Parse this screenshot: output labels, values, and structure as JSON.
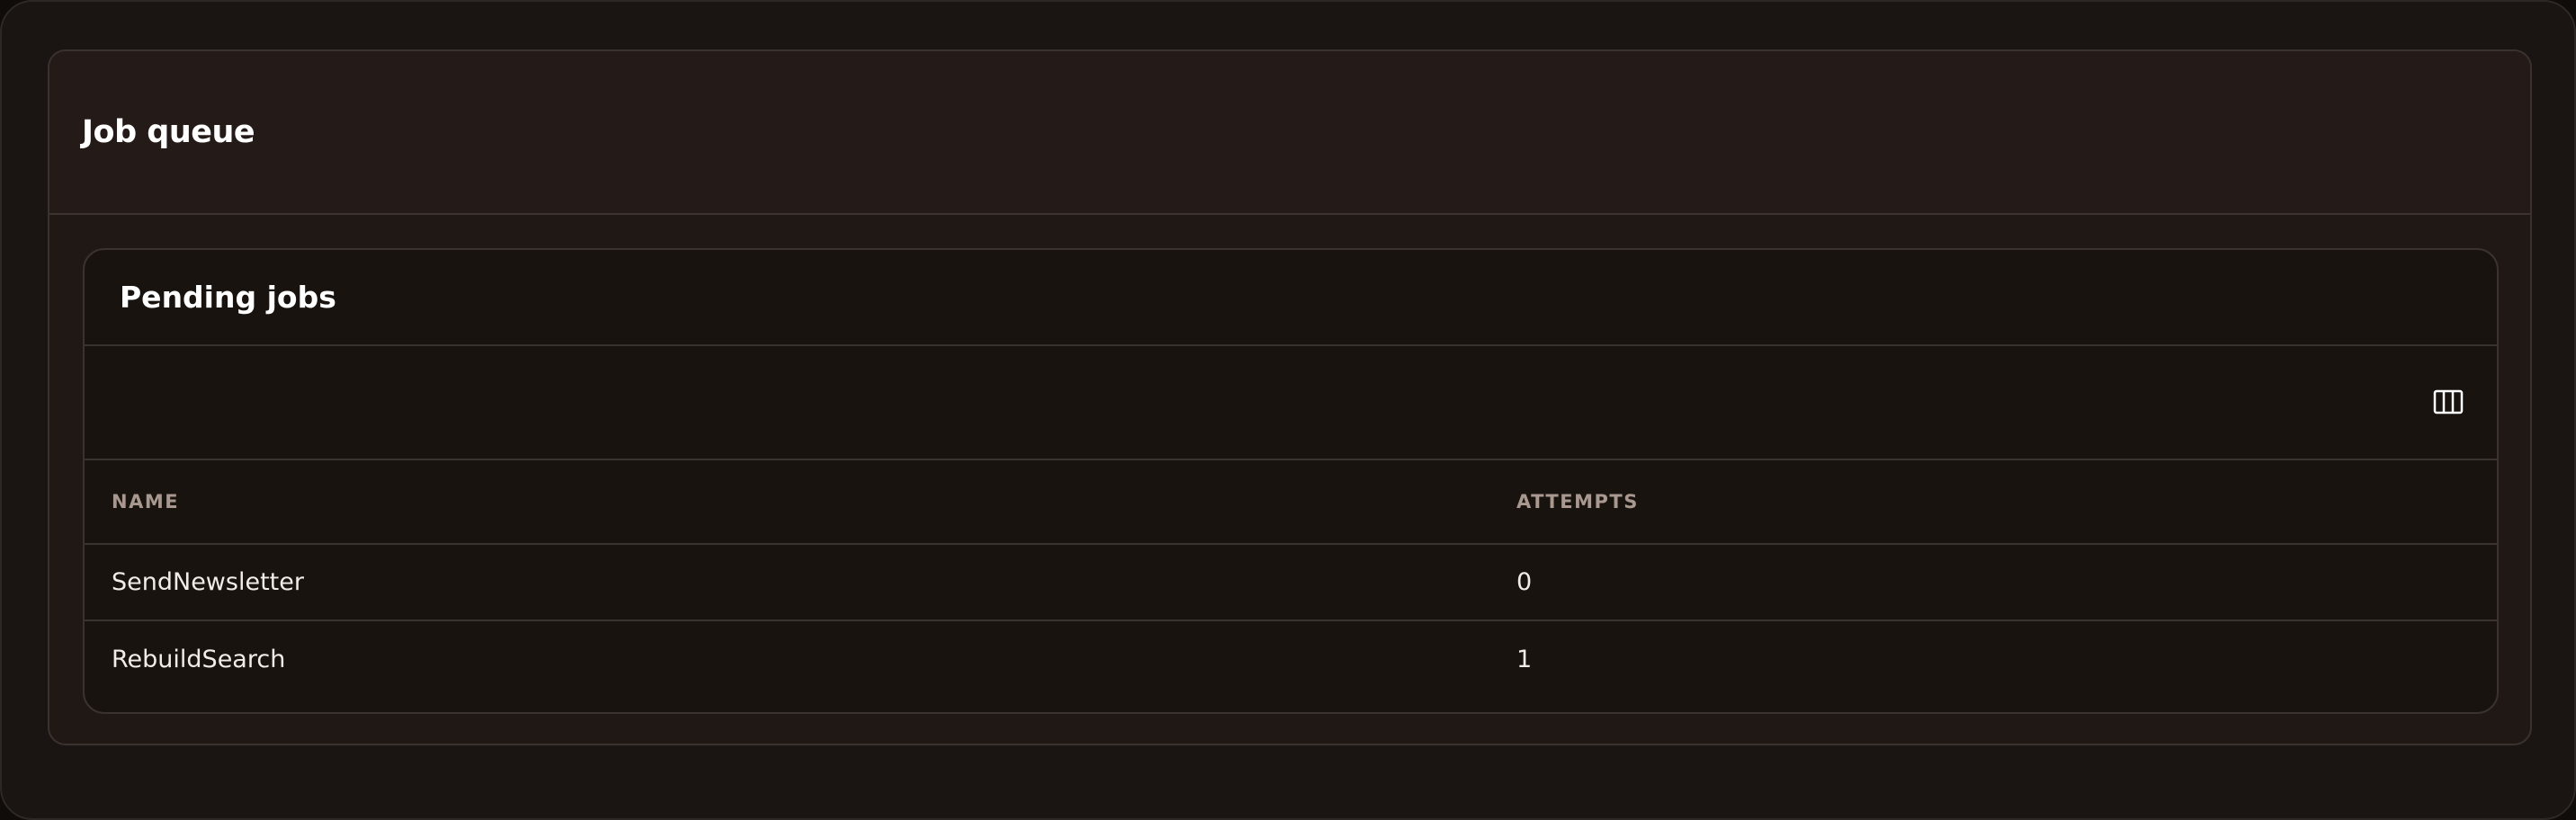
{
  "panel": {
    "title": "Job queue"
  },
  "card": {
    "title": "Pending jobs",
    "columns_icon": "columns-icon"
  },
  "table": {
    "headers": [
      "NAME",
      "ATTEMPTS"
    ],
    "rows": [
      {
        "name": "SendNewsletter",
        "attempts": "0"
      },
      {
        "name": "RebuildSearch",
        "attempts": "1"
      }
    ]
  }
}
